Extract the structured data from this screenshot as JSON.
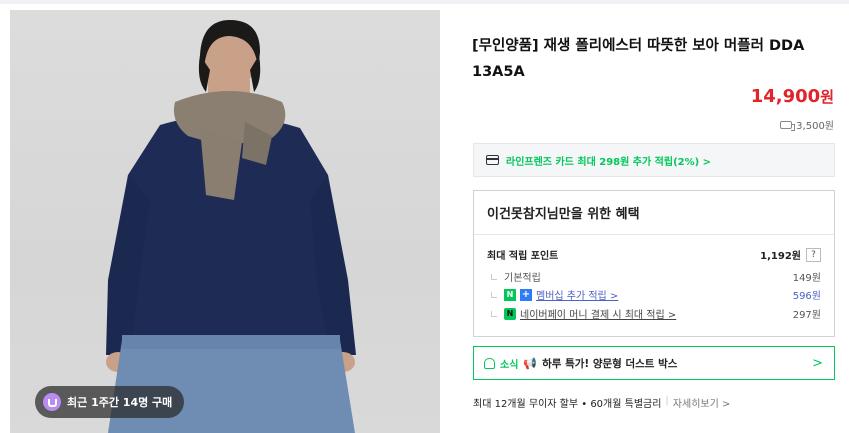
{
  "product": {
    "title": "[무인양품] 재생 폴리에스터 따뜻한 보아 머플러 DDA 13A5A",
    "price": "14,900",
    "price_unit": "원",
    "shipping": "3,500원",
    "recent_purchase": "최근 1주간 14명 구매"
  },
  "card_banner": {
    "text": "라인프렌즈 카드 최대 298원 추가 적립(2%) >"
  },
  "benefit": {
    "heading": "이건못참지님만을 위한 혜택",
    "max_points_label": "최대 적립 포인트",
    "max_points_value": "1,192원",
    "help": "?",
    "rows": [
      {
        "label": "기본적립",
        "value": "149원"
      },
      {
        "label": "멤버십 추가 적립 >",
        "value": "596원"
      },
      {
        "label": "네이버페이 머니 결제 시 최대 적립 >",
        "value": "297원"
      }
    ],
    "badges": {
      "n": "N",
      "plus": "+",
      "np": "N"
    }
  },
  "news": {
    "tag": "소식",
    "text": "하루 특가! 양문형 더스트 박스",
    "chevron": ">"
  },
  "installment": {
    "text": "최대 12개월 무이자 할부 • 60개월 특별금리",
    "sep": "|",
    "more": "자세히보기 >"
  },
  "colors": {
    "price_red": "#e1232a",
    "naver_green": "#03c75a",
    "link_blue": "#4d60c4"
  }
}
